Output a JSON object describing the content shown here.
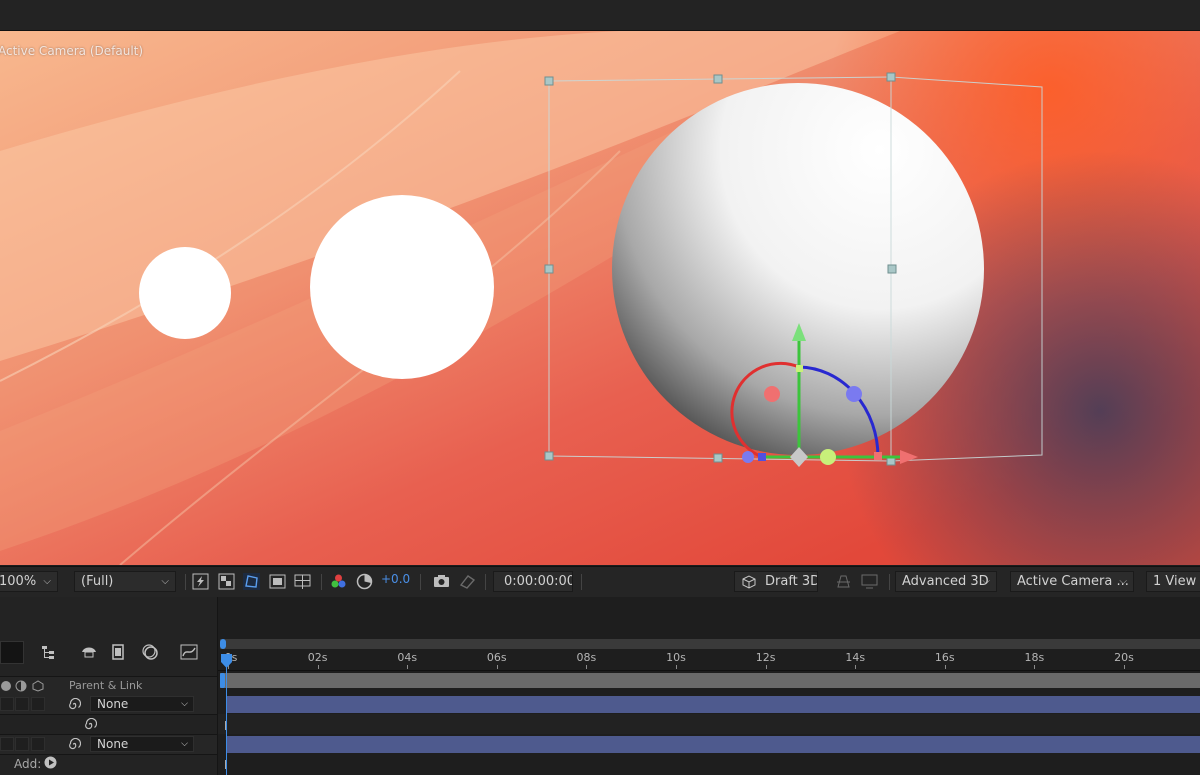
{
  "viewer": {
    "camera_label": "Active Camera (Default)"
  },
  "viewer_bar": {
    "zoom": "100%",
    "resolution": "(Full)",
    "exposure": "+0.0",
    "timecode": "0:00:00:00",
    "draft3d": "Draft 3D",
    "renderer": "Advanced 3D",
    "camera": "Active Camera ...",
    "views": "1 View",
    "icons": [
      "fast-preview-icon",
      "transparency-grid-icon",
      "mask-path-icon",
      "region-of-interest-icon",
      "grid-guides-icon",
      "color-channels-icon",
      "color-management-icon",
      "snapshot-camera-icon",
      "show-snapshot-icon",
      "draft-3d-icon",
      "floor-grid-icon",
      "extended-viewer-icon"
    ]
  },
  "timeline": {
    "parent_link_label": "Parent & Link",
    "layers": [
      {
        "parent": "None"
      },
      {
        "parent": "None"
      }
    ],
    "add_label": "Add:",
    "ruler": [
      "0s",
      "02s",
      "04s",
      "06s",
      "08s",
      "10s",
      "12s",
      "14s",
      "16s",
      "18s",
      "20s"
    ],
    "colors": {
      "layer_bar": "#4e5a8e",
      "playhead": "#3d8de6",
      "work_area": "#6a6a6a"
    }
  }
}
